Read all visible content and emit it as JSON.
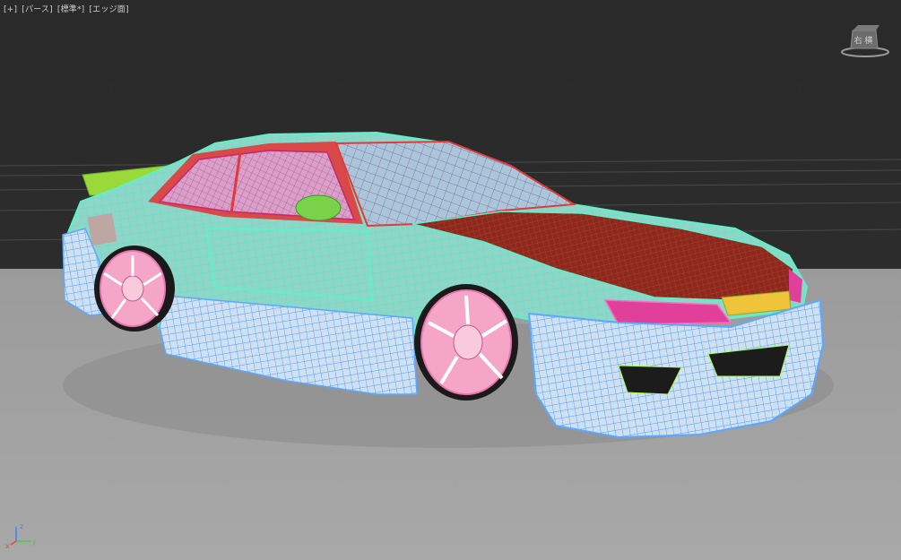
{
  "viewport": {
    "menu_plus": "[+]",
    "menu_view": "[パース]",
    "menu_shading": "[標準*]",
    "menu_display": "[エッジ面]"
  },
  "viewcube": {
    "face_label": "右 横"
  },
  "axis": {
    "x": "x",
    "y": "y",
    "z": "z"
  },
  "colors": {
    "body_wire": "#5ff0c8",
    "bumper_wire": "#5aa8ff",
    "hood_wire": "#7a0a0a",
    "wheel": "#f5a6c8",
    "glass_red": "#e03a3a",
    "wing": "#9ad93a"
  }
}
